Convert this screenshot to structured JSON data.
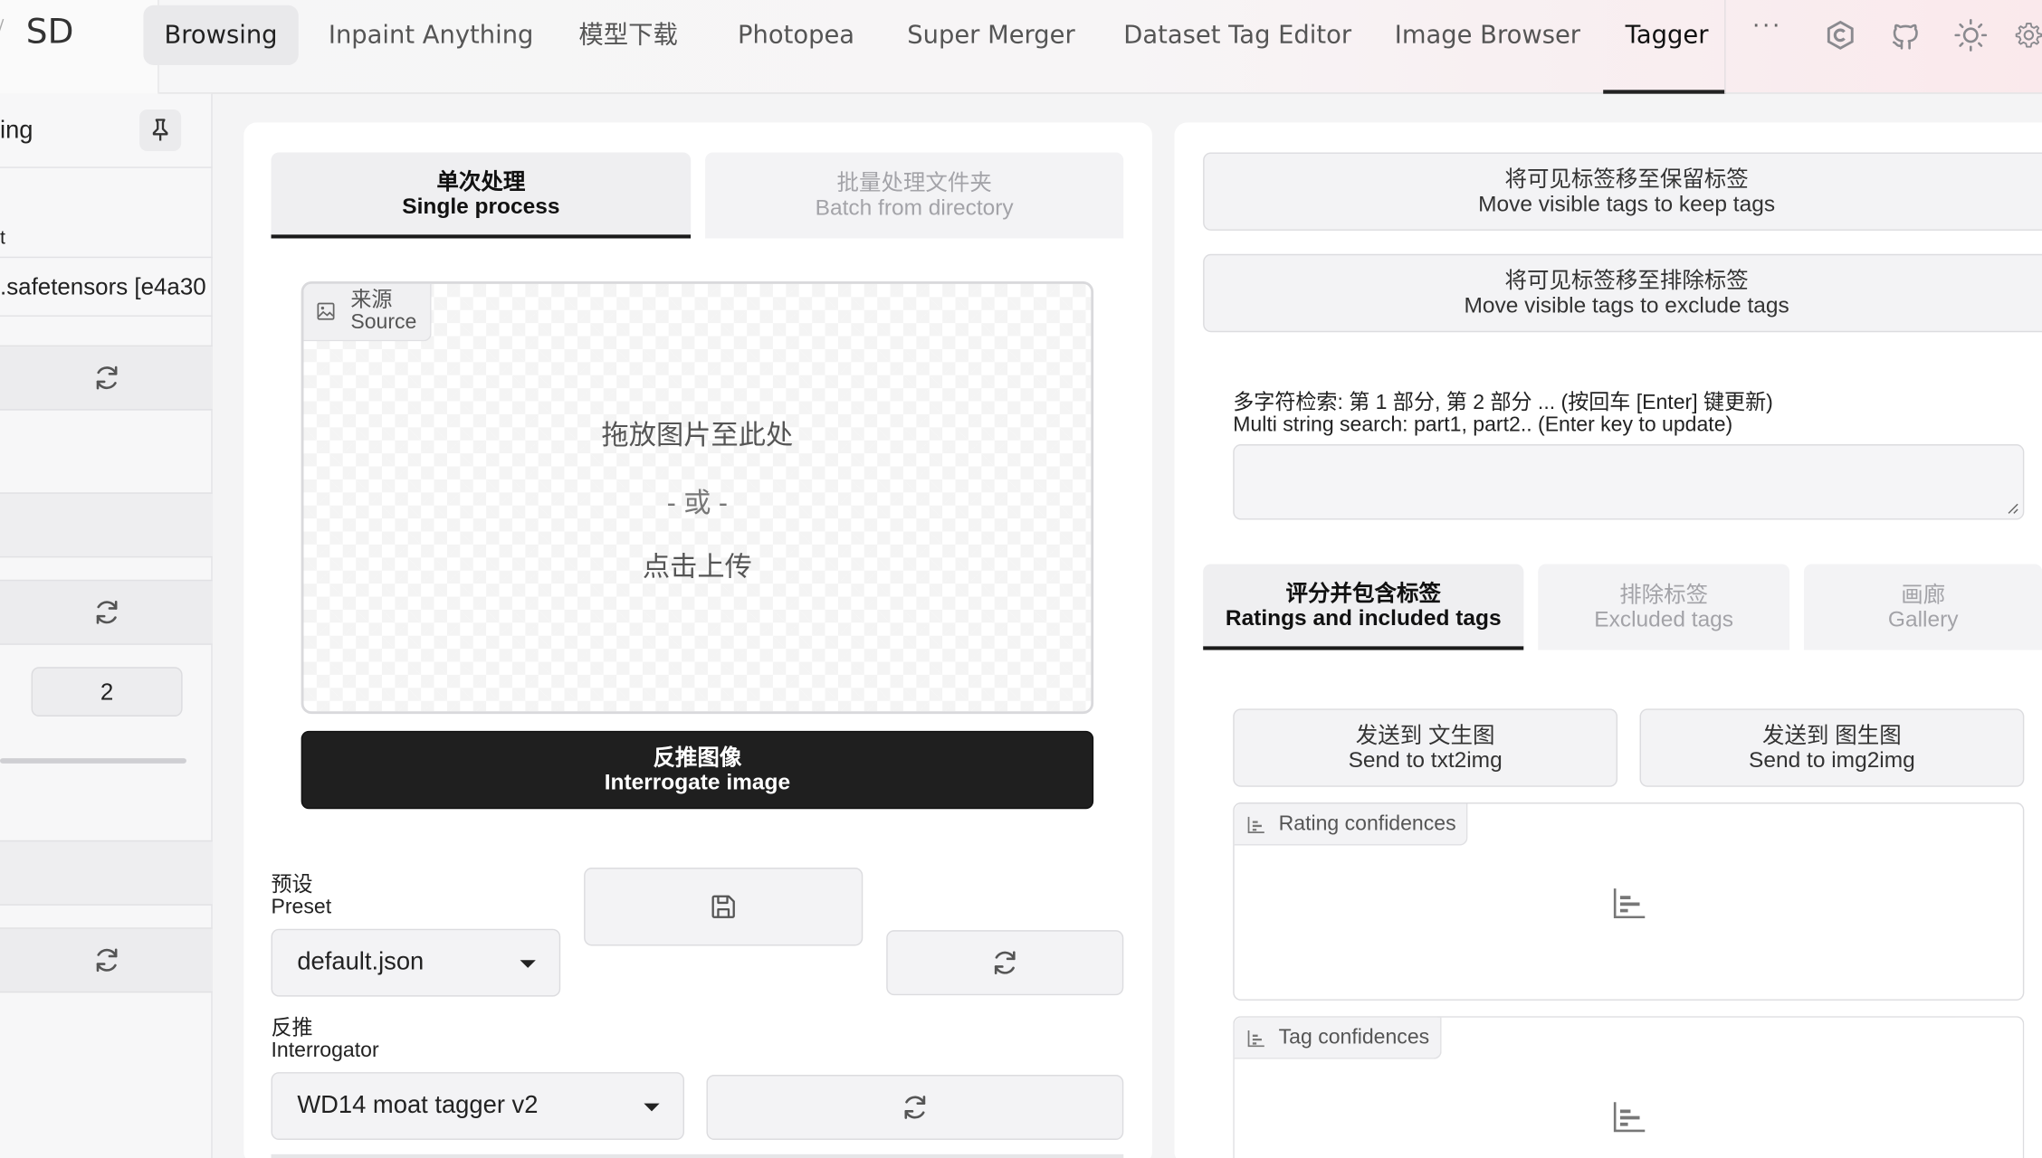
{
  "app": {
    "brand": "SD"
  },
  "nav": {
    "tabs": [
      {
        "label": "Browsing"
      },
      {
        "label": "Inpaint Anything"
      },
      {
        "label": "模型下载"
      },
      {
        "label": "Photopea"
      },
      {
        "label": "Super Merger"
      },
      {
        "label": "Dataset Tag Editor"
      },
      {
        "label": "Image Browser"
      },
      {
        "label": "Tagger"
      }
    ],
    "more": "···"
  },
  "sidebar": {
    "title": "ing",
    "fragment": "t",
    "model": ".safetensors [e4a30",
    "number_value": "2"
  },
  "left": {
    "subtabs": {
      "single_zh": "单次处理",
      "single_en": "Single process",
      "batch_zh": "批量处理文件夹",
      "batch_en": "Batch from directory"
    },
    "upload": {
      "label_zh": "来源",
      "label_en": "Source",
      "drop_text": "拖放图片至此处",
      "or_text": "- 或 -",
      "click_text": "点击上传"
    },
    "interrogate": {
      "zh": "反推图像",
      "en": "Interrogate image"
    },
    "preset": {
      "label_zh": "预设",
      "label_en": "Preset",
      "value": "default.json"
    },
    "interrogator": {
      "label_zh": "反推",
      "label_en": "Interrogator",
      "value": "WD14 moat tagger v2"
    }
  },
  "right": {
    "keep_btn": {
      "zh": "将可见标签移至保留标签",
      "en": "Move visible tags to keep tags"
    },
    "exclude_btn": {
      "zh": "将可见标签移至排除标签",
      "en": "Move visible tags to exclude tags"
    },
    "search": {
      "label_zh": "多字符检索: 第 1 部分, 第 2 部分 ... (按回车 [Enter] 键更新)",
      "label_en": "Multi string search: part1, part2.. (Enter key to update)",
      "value": ""
    },
    "tabs": {
      "ratings_zh": "评分并包含标签",
      "ratings_en": "Ratings and included tags",
      "excluded_zh": "排除标签",
      "excluded_en": "Excluded tags",
      "gallery_zh": "画廊",
      "gallery_en": "Gallery"
    },
    "send_txt2img": {
      "zh": "发送到 文生图",
      "en": "Send to txt2img"
    },
    "send_img2img": {
      "zh": "发送到 图生图",
      "en": "Send to img2img"
    },
    "rating_label": "Rating confidences",
    "tag_label": "Tag confidences"
  }
}
